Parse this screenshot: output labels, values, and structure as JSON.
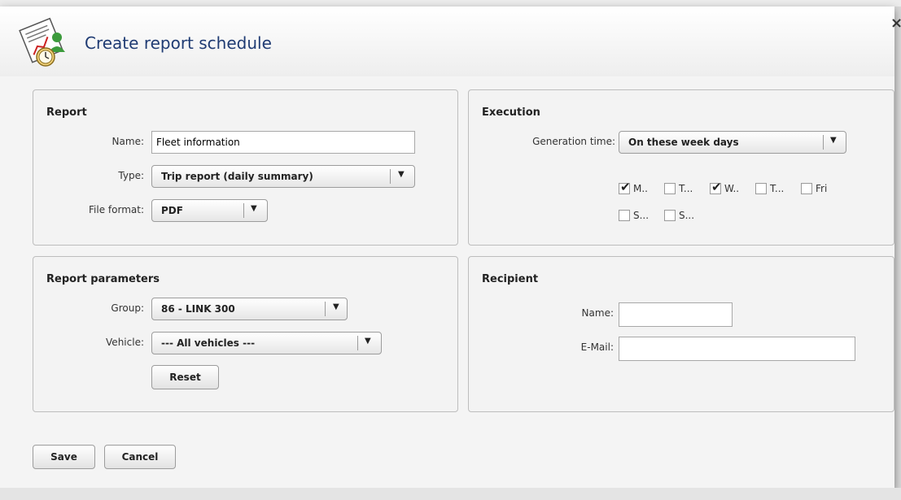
{
  "dialog": {
    "title": "Create report schedule",
    "close_label": "×"
  },
  "report": {
    "section_title": "Report",
    "name_label": "Name:",
    "name_value": "Fleet information",
    "type_label": "Type:",
    "type_value": "Trip report (daily summary)",
    "format_label": "File format:",
    "format_value": "PDF"
  },
  "execution": {
    "section_title": "Execution",
    "gen_label": "Generation time:",
    "gen_value": "On these week days",
    "days": [
      {
        "label": "M..",
        "checked": true
      },
      {
        "label": "T...",
        "checked": false
      },
      {
        "label": "W..",
        "checked": true
      },
      {
        "label": "T...",
        "checked": false
      },
      {
        "label": "Fri",
        "checked": false
      },
      {
        "label": "S...",
        "checked": false
      },
      {
        "label": "S...",
        "checked": false
      }
    ]
  },
  "params": {
    "section_title": "Report parameters",
    "group_label": "Group:",
    "group_value": "86 - LINK 300",
    "vehicle_label": "Vehicle:",
    "vehicle_value": "--- All vehicles ---",
    "reset_label": "Reset"
  },
  "recipient": {
    "section_title": "Recipient",
    "name_label": "Name:",
    "name_value": "",
    "email_label": "E-Mail:",
    "email_value": ""
  },
  "footer": {
    "save_label": "Save",
    "cancel_label": "Cancel"
  },
  "icons": {
    "dropdown": "▼",
    "check": "✔",
    "report_icon": "report-schedule-icon"
  }
}
